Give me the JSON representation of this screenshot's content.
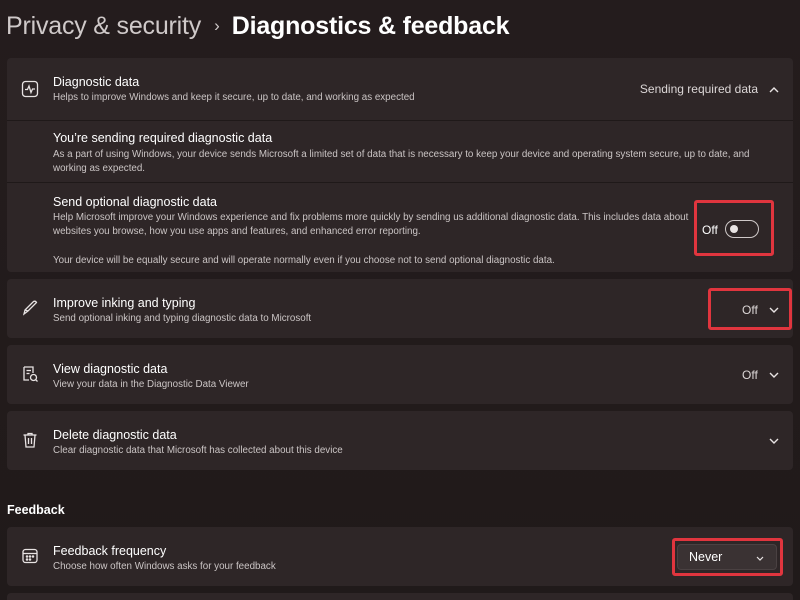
{
  "breadcrumb": {
    "parent": "Privacy & security",
    "separator": "›",
    "current": "Diagnostics & feedback"
  },
  "diagnostic_data": {
    "icon": "pulse-chart-icon",
    "title": "Diagnostic data",
    "description": "Helps to improve Windows and keep it secure, up to date, and working as expected",
    "status": "Sending required data",
    "expanded": true,
    "required": {
      "title": "You’re sending required diagnostic data",
      "description": "As a part of using Windows, your device sends Microsoft a limited set of data that is necessary to keep your device and operating system secure, up to date, and working as expected."
    },
    "optional": {
      "title": "Send optional diagnostic data",
      "description": "Help Microsoft improve your Windows experience and fix problems more quickly by sending us additional diagnostic data. This includes data about websites you browse, how you use apps and features, and enhanced error reporting.",
      "note": "Your device will be equally secure and will operate normally even if you choose not to send optional diagnostic data.",
      "toggle_label": "Off",
      "toggle_on": false
    }
  },
  "inking_typing": {
    "icon": "pen-icon",
    "title": "Improve inking and typing",
    "description": "Send optional inking and typing diagnostic data to Microsoft",
    "value": "Off"
  },
  "view_diagnostic": {
    "icon": "document-search-icon",
    "title": "View diagnostic data",
    "description": "View your data in the Diagnostic Data Viewer",
    "value": "Off"
  },
  "delete_diagnostic": {
    "icon": "trash-icon",
    "title": "Delete diagnostic data",
    "description": "Clear diagnostic data that Microsoft has collected about this device"
  },
  "feedback": {
    "section_label": "Feedback",
    "frequency": {
      "icon": "calendar-icon",
      "title": "Feedback frequency",
      "description": "Choose how often Windows asks for your feedback",
      "selected": "Never"
    }
  },
  "colors": {
    "background": "#231c1c",
    "card": "#2e2627",
    "highlight": "#e0353e",
    "text_primary": "#ffffff",
    "text_secondary": "#cbc5c5"
  }
}
